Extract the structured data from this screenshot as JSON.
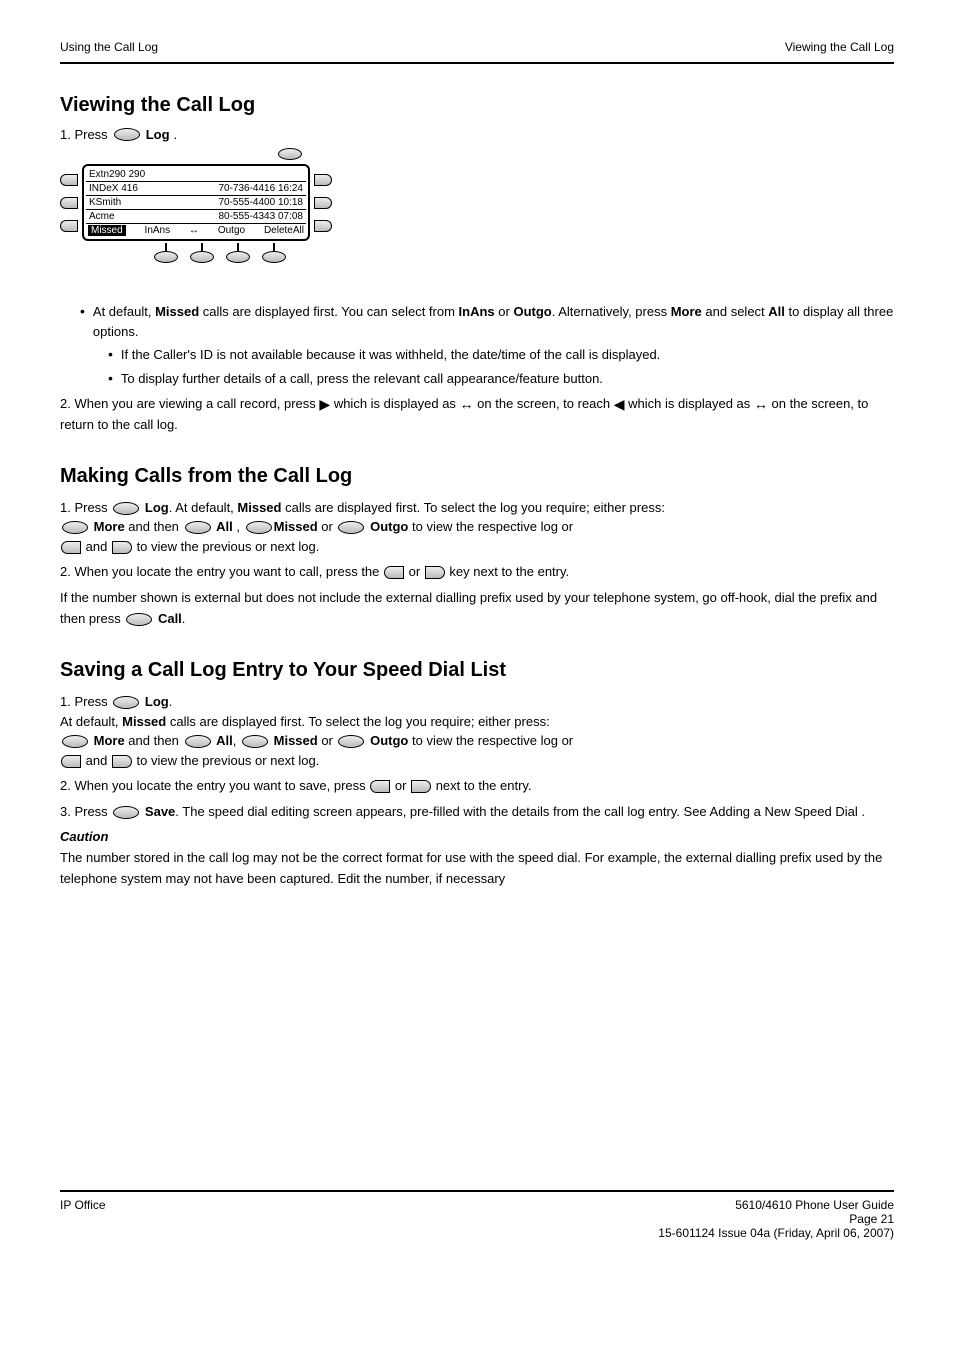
{
  "header": {
    "left": "Using the Call Log",
    "right": "Viewing the Call Log"
  },
  "section1": {
    "title": "Viewing the Call Log",
    "step1_pre": "1. Press ",
    "step1_btn": "Log",
    "step1_post": "."
  },
  "screen": {
    "title": "Extn290 290",
    "rows": [
      {
        "name": "INDeX 416",
        "num": "70-736-4416 16:24"
      },
      {
        "name": "KSmith",
        "num": "70-555-4400 10:18"
      },
      {
        "name": "Acme",
        "num": "80-555-4343 07:08"
      }
    ],
    "softkeys": {
      "sel": "Missed",
      "k2": "InAns",
      "k3": "Outgo",
      "k4": "DeleteAll"
    }
  },
  "notes": {
    "bullet1_a": "At default, ",
    "bullet1_b": "Missed",
    "bullet1_c": " calls are displayed first. You can select from ",
    "bullet1_d": "InAns",
    "bullet1_e": " or ",
    "bullet1_f": "Outgo",
    "bullet1_g": ". Alternatively, press ",
    "bullet1_h": "More",
    "bullet1_i": " and select ",
    "bullet1_j": "All",
    "bullet1_k": " to display all three options.",
    "nested1": "If the Caller's ID is not available because it was withheld, the date/time of the call is displayed.",
    "nested2": "To display further details of a call, press the relevant call appearance/feature button.",
    "step2_a": "2. When you are viewing a call record, press ",
    "step2_b": " which is displayed as ",
    "step2_c": " on the screen, to reach ",
    "step2_d": " which is displayed as ",
    "step2_e": " on the screen, to return to the call log."
  },
  "section2": {
    "title": "Making Calls from the Call Log",
    "s1_a": "1. Press ",
    "s1_btn": "Log",
    "s1_b": ". At default, ",
    "s1_c": "Missed",
    "s1_d": " calls are displayed first. To select the log you require; either press:",
    "s1_e": "More ",
    "s1_f": "and then  ",
    "s1_g": "All ",
    "s1_h": ", ",
    "s1_i": "Missed ",
    "s1_j": " or  ",
    "s1_k": "Outgo ",
    "s1_l": " to view the respective log or ",
    "s1_m": "and",
    "s1_n": " to view the previous or next log.",
    "s2_a": "2. When you locate the entry you want to call, press the  ",
    "s2_b": " or  ",
    "s2_c": " key next to the entry.",
    "s2_note": "If the number shown is external but does not include the external dialling prefix used by your telephone system, go off-hook, dial the prefix and then press ",
    "s2_note_btn": "Call"
  },
  "section3": {
    "title": "Saving a Call Log Entry to Your Speed Dial List",
    "s1_a": "1. Press ",
    "s1_btn": "Log",
    "s1_b": ".",
    "s1_c": "At default, ",
    "s1_d": "Missed",
    "s1_e": " calls are displayed first. To select the log you require; either press:",
    "s1_f": "More ",
    "s1_g": "and then ",
    "s1_h": "All",
    "s1_i": ", ",
    "s1_j": "Missed ",
    "s1_k": " or ",
    "s1_l": "Outgo",
    "s1_m": " to view the respective log or ",
    "s1_n": " and ",
    "s1_o": " to view the previous or next log.",
    "s2_a": "2. When you locate the entry you want to save, press ",
    "s2_b": " or ",
    "s2_c": " next to the entry.",
    "s3_a": "3. Press ",
    "s3_btn": "Save",
    "s3_b": ". The speed dial editing screen appears, pre-filled with the details from the call log entry. See Adding a New Speed Dial .",
    "caution_label": "Caution",
    "caution_text": "The number stored in the call log may not be the correct format for use with the speed dial. For example, the external dialling prefix used by the telephone system may not have been captured. Edit the number, if necessary"
  },
  "footer": {
    "left": "IP Office",
    "right1": "5610/4610 Phone User Guide",
    "right2": "Page 21",
    "right3": "15-601124 Issue 04a (Friday, April 06, 2007)"
  }
}
